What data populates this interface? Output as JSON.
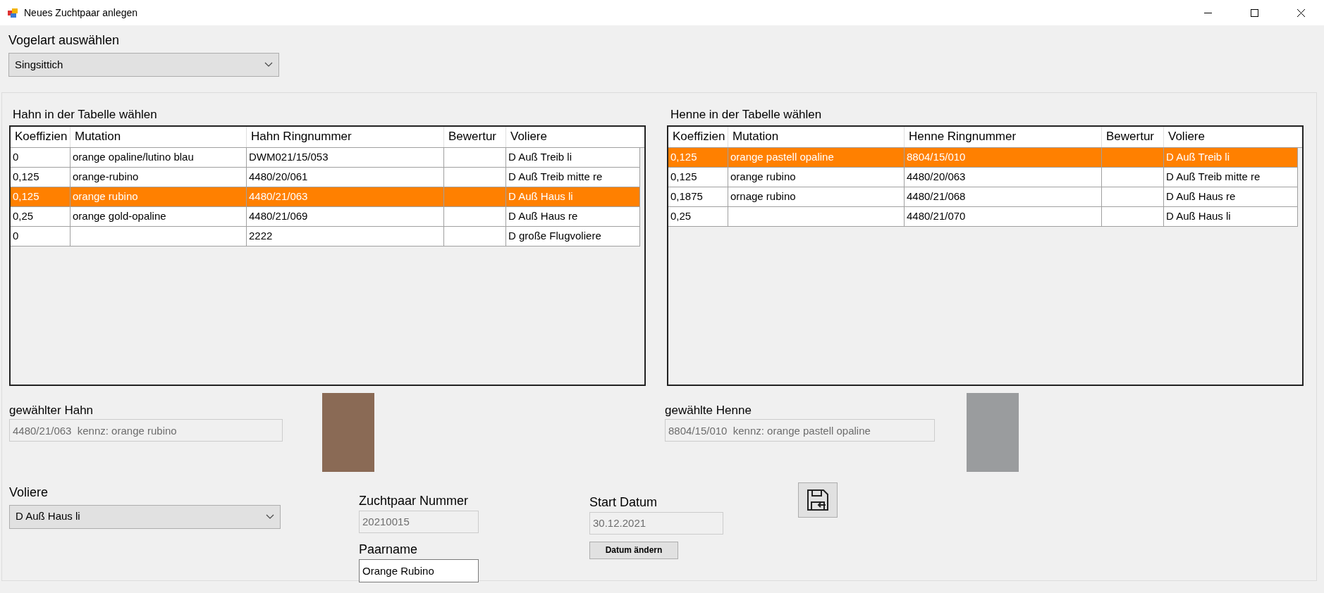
{
  "window": {
    "title": "Neues Zuchtpaar anlegen"
  },
  "species_select": {
    "label": "Vogelart auswählen",
    "value": "Singsittich"
  },
  "hahn_table": {
    "title": "Hahn in der Tabelle wählen",
    "columns": [
      "Koeffizien",
      "Mutation",
      "Hahn Ringnummer",
      "Bewertur",
      "Voliere"
    ],
    "rows": [
      {
        "cells": [
          "0",
          "orange opaline/lutino blau",
          "DWM021/15/053",
          "",
          "D Auß Treib li"
        ],
        "selected": false
      },
      {
        "cells": [
          "0,125",
          "orange-rubino",
          "4480/20/061",
          "",
          "D Auß Treib mitte re"
        ],
        "selected": false
      },
      {
        "cells": [
          "0,125",
          "orange rubino",
          "4480/21/063",
          "",
          "D Auß Haus li"
        ],
        "selected": true
      },
      {
        "cells": [
          "0,25",
          "orange gold-opaline",
          "4480/21/069",
          "",
          "D Auß Haus re"
        ],
        "selected": false
      },
      {
        "cells": [
          "0",
          "",
          "2222",
          "",
          "D große Flugvoliere"
        ],
        "selected": false
      }
    ]
  },
  "henne_table": {
    "title": "Henne in der Tabelle wählen",
    "columns": [
      "Koeffizien",
      "Mutation",
      "Henne Ringnummer",
      "Bewertur",
      "Voliere"
    ],
    "rows": [
      {
        "cells": [
          "0,125",
          "orange pastell opaline",
          "8804/15/010",
          "",
          "D Auß Treib li"
        ],
        "selected": true
      },
      {
        "cells": [
          "0,125",
          "orange rubino",
          "4480/20/063",
          "",
          "D Auß Treib mitte re"
        ],
        "selected": false
      },
      {
        "cells": [
          "0,1875",
          "ornage rubino",
          "4480/21/068",
          "",
          "D Auß Haus re"
        ],
        "selected": false
      },
      {
        "cells": [
          "0,25",
          "",
          "4480/21/070",
          "",
          "D Auß Haus li"
        ],
        "selected": false
      }
    ]
  },
  "selected_hahn": {
    "label": "gewählter Hahn",
    "value": "4480/21/063  kennz: orange rubino",
    "disabled": true
  },
  "selected_henne": {
    "label": "gewählte Henne",
    "value": "8804/15/010  kennz: orange pastell opaline",
    "disabled": true
  },
  "aviary_select": {
    "label": "Voliere",
    "value": "D Auß Haus li"
  },
  "pair_number": {
    "label": "Zuchtpaar Nummer",
    "value": "20210015",
    "disabled": true
  },
  "pair_name": {
    "label": "Paarname",
    "value": "Orange Rubino",
    "disabled": false
  },
  "start_date": {
    "label": "Start Datum",
    "value": "30.12.2021",
    "disabled": true
  },
  "change_date_button": {
    "label": "Datum ändern"
  }
}
